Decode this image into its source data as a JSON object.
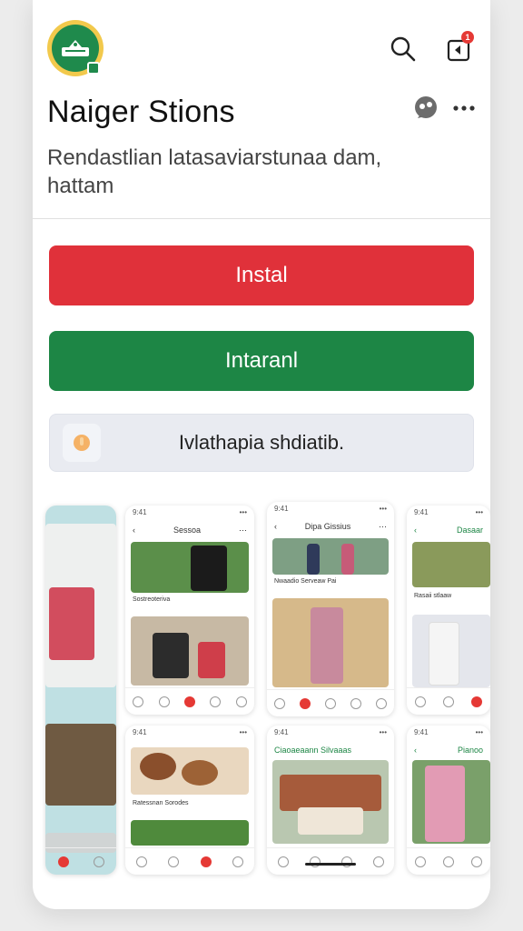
{
  "app": {
    "title": "Naiger Stions",
    "description": "Rendastlian latasaviarstunaa dam, hattam",
    "icon": "app-logo-icon",
    "notification_count": "1"
  },
  "actions": {
    "install_label": "Instal",
    "internal_label": "Intaranl",
    "secondary_label": "Ivlathapia shdiatib."
  },
  "colors": {
    "install": "#e0313a",
    "internal": "#1d8645",
    "secondary": "#e9ebf1"
  },
  "screenshots": [
    {
      "title": "",
      "caption": ""
    },
    {
      "title": "Sessoa",
      "caption": "Sostreoteriva"
    },
    {
      "title": "Dipa Gissius",
      "caption": "Nwaadio Serveaw Pai"
    },
    {
      "title": "Dasaar",
      "caption": "Rasaii stlaaw"
    },
    {
      "title": "",
      "caption": "Ratessnan Sorodes"
    },
    {
      "title": "Ciaoaeaann Silvaaas",
      "caption": ""
    },
    {
      "title": "Pianoo",
      "caption": ""
    }
  ]
}
